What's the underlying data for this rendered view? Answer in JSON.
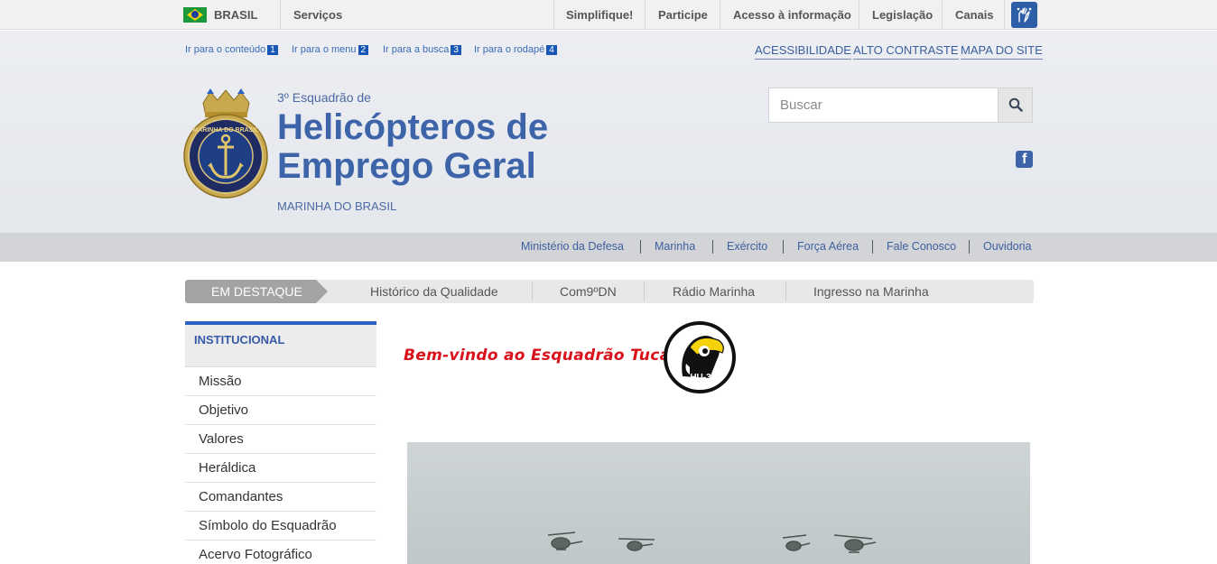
{
  "govbar": {
    "brand": "BRASIL",
    "servicos": "Serviços",
    "links": [
      "Simplifique!",
      "Participe",
      "Acesso à informação",
      "Legislação",
      "Canais"
    ]
  },
  "skip_links": [
    {
      "label": "Ir para o conteúdo",
      "num": "1"
    },
    {
      "label": "Ir para o menu",
      "num": "2"
    },
    {
      "label": "Ir para a busca",
      "num": "3"
    },
    {
      "label": "Ir para o rodapé",
      "num": "4"
    }
  ],
  "accessibility": [
    "ACESSIBILIDADE",
    "ALTO CONTRASTE",
    "MAPA DO SITE"
  ],
  "header": {
    "pre_title": "3º Esquadrão de",
    "title_line1": "Helicópteros de",
    "title_line2": "Emprego Geral",
    "subtitle": "MARINHA DO BRASIL",
    "emblem_text": "MARINHA DO BRASIL"
  },
  "search": {
    "placeholder": "Buscar"
  },
  "linkbar": [
    "Ministério da Defesa",
    "Marinha",
    "Exército",
    "Força Aérea",
    "Fale Conosco",
    "Ouvidoria"
  ],
  "destaque": {
    "label": "EM DESTAQUE",
    "items": [
      "Histórico da Qualidade",
      "Com9ºDN",
      "Rádio Marinha",
      "Ingresso na Marinha"
    ]
  },
  "menu": {
    "head": "INSTITUCIONAL",
    "items": [
      "Missão",
      "Objetivo",
      "Valores",
      "Heráldica",
      "Comandantes",
      "Símbolo do Esquadrão",
      "Acervo Fotográfico"
    ]
  },
  "main": {
    "welcome": "Bem-vindo ao Esquadrão Tucano!",
    "logo_text": "HU-3"
  },
  "colors": {
    "accent": "#3d64a8",
    "welcome": "#d9111b",
    "menu_border": "#2d64c4"
  }
}
